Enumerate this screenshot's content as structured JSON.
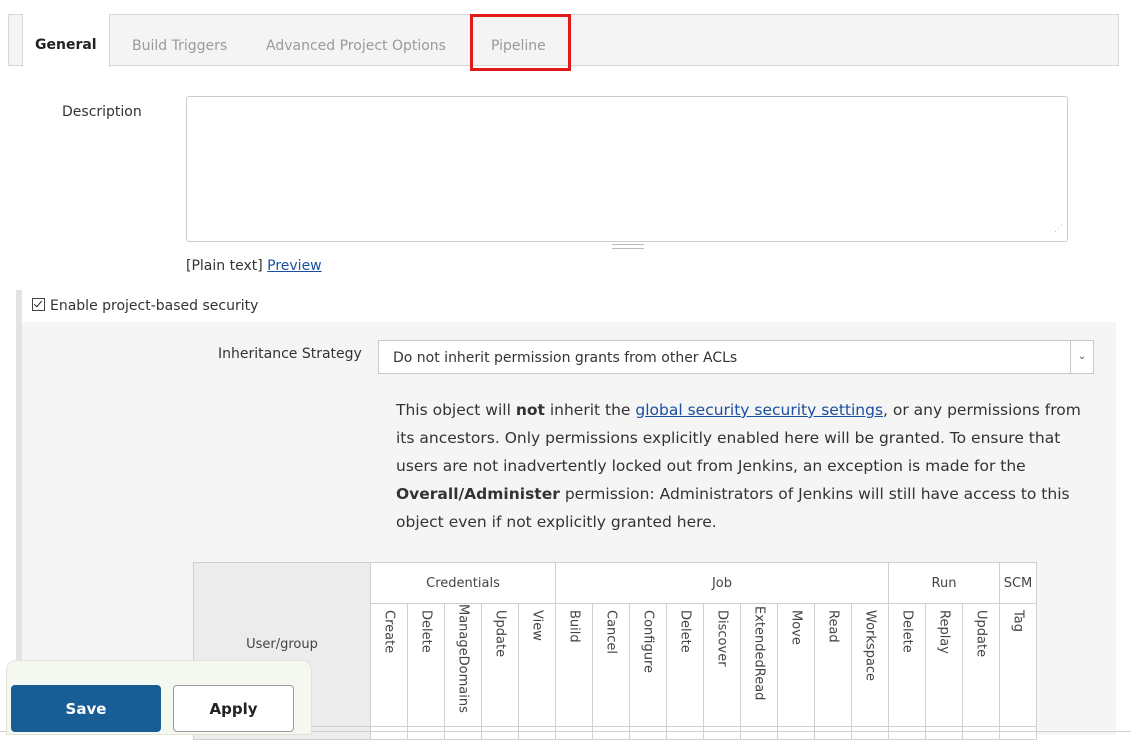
{
  "tabs": [
    {
      "label": "General",
      "active": true
    },
    {
      "label": "Build Triggers"
    },
    {
      "label": "Advanced Project Options"
    },
    {
      "label": "Pipeline",
      "highlighted": true
    }
  ],
  "description": {
    "label": "Description",
    "value": "",
    "format_text": "[Plain text]",
    "preview_link": "Preview"
  },
  "security": {
    "checkbox_label": "Enable project-based security",
    "checked": true,
    "inheritance_label": "Inheritance Strategy",
    "inheritance_value": "Do not inherit permission grants from other ACLs",
    "info": {
      "p1": "This object will ",
      "bold1": "not",
      "p2": " inherit the ",
      "link": "global security security settings",
      "p3": ", or any permissions from its ancestors. Only permissions explicitly enabled here will be granted. To ensure that users are not inadvertently locked out from Jenkins, an exception is made for the ",
      "bold2": "Overall/Administer",
      "p4": " permission: Administrators of Jenkins will still have access to this object even if not explicitly granted here."
    }
  },
  "permissions": {
    "user_group_header": "User/group",
    "groups": [
      {
        "name": "Credentials",
        "columns": [
          "Create",
          "Delete",
          "ManageDomains",
          "Update",
          "View"
        ]
      },
      {
        "name": "Job",
        "columns": [
          "Build",
          "Cancel",
          "Configure",
          "Delete",
          "Discover",
          "ExtendedRead",
          "Move",
          "Read",
          "Workspace"
        ]
      },
      {
        "name": "Run",
        "columns": [
          "Delete",
          "Replay",
          "Update"
        ]
      },
      {
        "name": "SCM",
        "columns": [
          "Tag"
        ]
      }
    ]
  },
  "buttons": {
    "save": "Save",
    "apply": "Apply"
  },
  "colors": {
    "highlight": "#e21919",
    "save_button": "#185d96",
    "link": "#1a4fa0"
  }
}
